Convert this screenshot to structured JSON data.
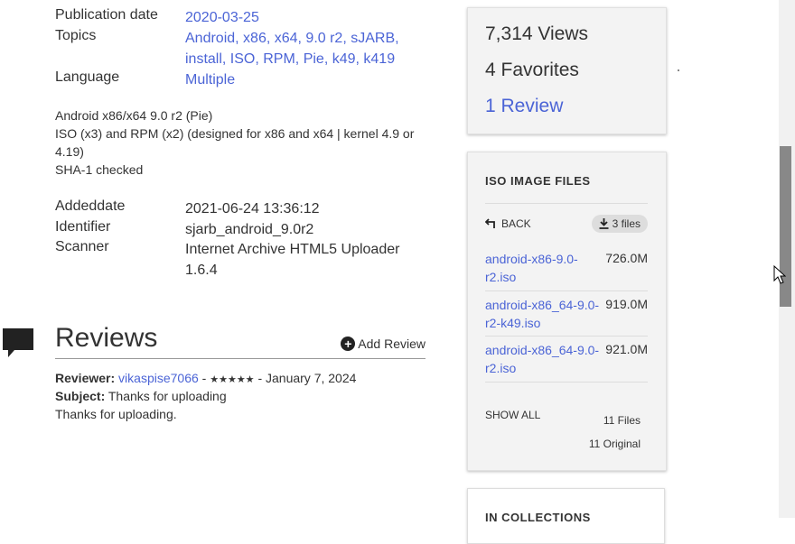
{
  "metadata": [
    {
      "label": "Publication date",
      "value": "2020-03-25",
      "link": true
    },
    {
      "label": "Topics",
      "value": "Android, x86, x64, 9.0 r2, sJARB, install, ISO, RPM, Pie, k49, k419",
      "link": true
    },
    {
      "label": "Language",
      "value": "Multiple",
      "link": true
    }
  ],
  "description": [
    "Android x86/x64 9.0 r2 (Pie)",
    "ISO (x3) and RPM (x2) (designed for x86 and x64 | kernel 4.9 or 4.19)",
    "SHA-1 checked"
  ],
  "metadata2": [
    {
      "label": "Addeddate",
      "value": "2021-06-24 13:36:12"
    },
    {
      "label": "Identifier",
      "value": "sjarb_android_9.0r2"
    },
    {
      "label": "Scanner",
      "value": "Internet Archive HTML5 Uploader 1.6.4"
    }
  ],
  "reviews": {
    "title": "Reviews",
    "add_label": "Add Review",
    "reviewer_label": "Reviewer:",
    "reviewer": "vikaspise7066",
    "stars": "★★★★★",
    "date": "January 7, 2024",
    "subject_label": "Subject:",
    "subject": "Thanks for uploading",
    "body": "Thanks for uploading."
  },
  "stats": {
    "views": "7,314 Views",
    "favorites": "4 Favorites",
    "reviews": "1 Review"
  },
  "files": {
    "title": "ISO IMAGE FILES",
    "back": "BACK",
    "count": "3 files",
    "items": [
      {
        "name": "android-x86-9.0-r2.iso",
        "size": "726.0M"
      },
      {
        "name": "android-x86_64-9.0-r2-k49.iso",
        "size": "919.0M"
      },
      {
        "name": "android-x86_64-9.0-r2.iso",
        "size": "921.0M"
      }
    ],
    "show_all": "SHOW ALL",
    "total_files": "11 Files",
    "total_original": "11 Original"
  },
  "collections": {
    "title": "IN COLLECTIONS"
  },
  "colors": {
    "link": "#4b64d6",
    "text": "#333333",
    "card_bg": "#f3f3f3"
  }
}
